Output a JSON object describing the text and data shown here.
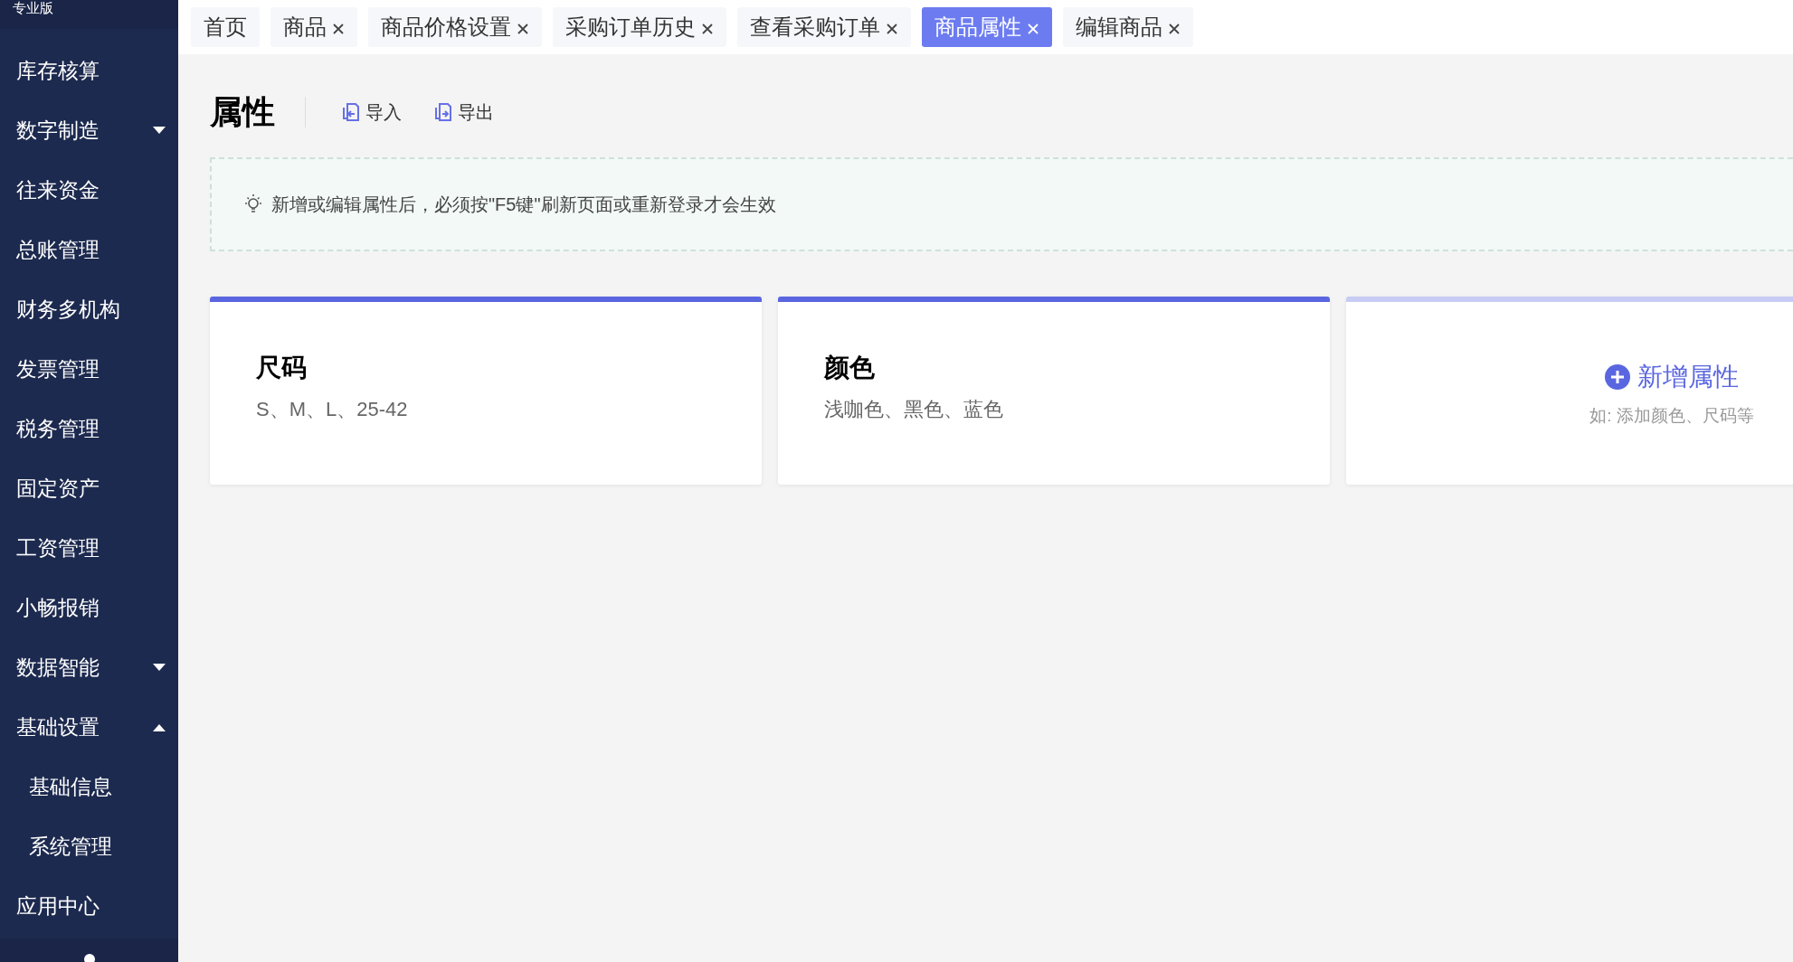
{
  "sidebar": {
    "edition_badge": "专业版",
    "items": [
      {
        "label": "库存核算",
        "kind": "link"
      },
      {
        "label": "数字制造",
        "kind": "group",
        "expanded": false
      },
      {
        "label": "往来资金",
        "kind": "link"
      },
      {
        "label": "总账管理",
        "kind": "link"
      },
      {
        "label": "财务多机构",
        "kind": "link"
      },
      {
        "label": "发票管理",
        "kind": "link"
      },
      {
        "label": "税务管理",
        "kind": "link"
      },
      {
        "label": "固定资产",
        "kind": "link"
      },
      {
        "label": "工资管理",
        "kind": "link"
      },
      {
        "label": "小畅报销",
        "kind": "link"
      },
      {
        "label": "数据智能",
        "kind": "group",
        "expanded": false
      },
      {
        "label": "基础设置",
        "kind": "group",
        "expanded": true,
        "children": [
          {
            "label": "基础信息"
          },
          {
            "label": "系统管理"
          }
        ]
      },
      {
        "label": "应用中心",
        "kind": "link"
      }
    ]
  },
  "tabs": [
    {
      "label": "首页",
      "selected": false,
      "closable": false
    },
    {
      "label": "商品",
      "selected": false,
      "closable": true
    },
    {
      "label": "商品价格设置",
      "selected": false,
      "closable": true
    },
    {
      "label": "采购订单历史",
      "selected": false,
      "closable": true
    },
    {
      "label": "查看采购订单",
      "selected": false,
      "closable": true
    },
    {
      "label": "商品属性",
      "selected": true,
      "closable": true
    },
    {
      "label": "编辑商品",
      "selected": false,
      "closable": true
    }
  ],
  "page": {
    "title": "属性",
    "actions": [
      {
        "label": "导入",
        "kind": "import"
      },
      {
        "label": "导出",
        "kind": "export"
      }
    ],
    "hint": "新增或编辑属性后，必须按\"F5键\"刷新页面或重新登录才会生效",
    "cards": [
      {
        "kind": "attribute",
        "name": "尺码",
        "values": "S、M、L、25-42"
      },
      {
        "kind": "attribute",
        "name": "颜色",
        "values": "浅咖色、黑色、蓝色"
      },
      {
        "kind": "add",
        "name": "新增属性",
        "values": "如: 添加颜色、尺码等"
      }
    ]
  }
}
